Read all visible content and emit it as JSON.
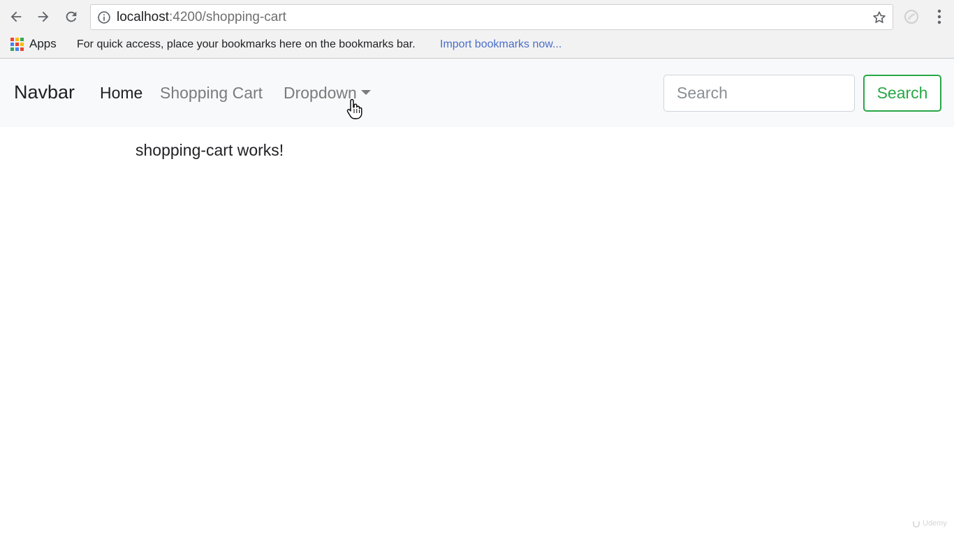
{
  "browser": {
    "url_host": "localhost",
    "url_path": ":4200/shopping-cart",
    "icons": {
      "back": "arrow-left-icon",
      "forward": "arrow-right-icon",
      "reload": "reload-icon",
      "info": "info-icon",
      "bookmark_star": "star-icon",
      "extension": "extension-icon",
      "menu": "kebab-menu-icon"
    }
  },
  "bookmarks_bar": {
    "apps_label": "Apps",
    "hint": "For quick access, place your bookmarks here on the bookmarks bar.",
    "import_link": "Import bookmarks now..."
  },
  "navbar": {
    "brand": "Navbar",
    "links": [
      {
        "label": "Home",
        "active": true
      },
      {
        "label": "Shopping Cart",
        "active": false
      },
      {
        "label": "Dropdown",
        "active": false,
        "has_caret": true
      }
    ],
    "search_placeholder": "Search",
    "search_button": "Search"
  },
  "main": {
    "message": "shopping-cart works!"
  },
  "watermark": {
    "text": "Udemy"
  },
  "colors": {
    "navbar_bg": "#f8f9fa",
    "success_green": "#28a745",
    "link_blue": "#4a6ec9"
  }
}
